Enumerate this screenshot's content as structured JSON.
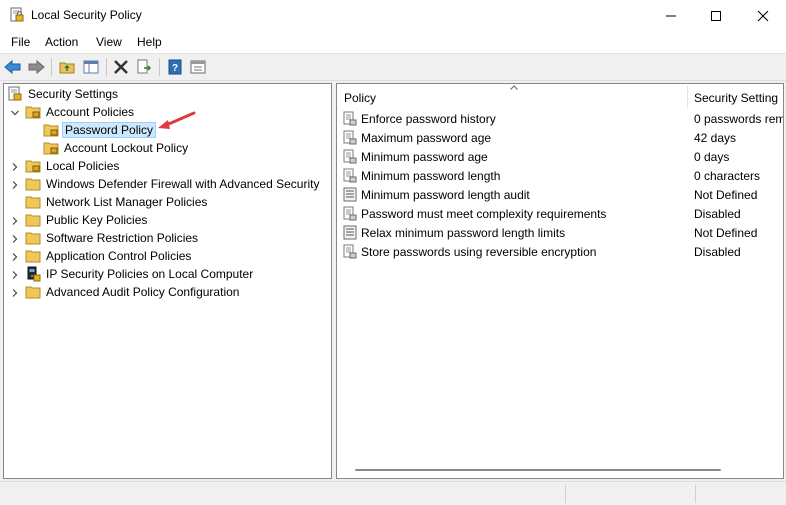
{
  "window": {
    "title": "Local Security Policy"
  },
  "menu": {
    "file": "File",
    "action": "Action",
    "view": "View",
    "help": "Help"
  },
  "tree": {
    "root": "Security Settings",
    "account_policies": "Account Policies",
    "password_policy": "Password Policy",
    "account_lockout_policy": "Account Lockout Policy",
    "local_policies": "Local Policies",
    "firewall": "Windows Defender Firewall with Advanced Security",
    "network_list": "Network List Manager Policies",
    "public_key": "Public Key Policies",
    "software_restriction": "Software Restriction Policies",
    "application_control": "Application Control Policies",
    "ip_security": "IP Security Policies on Local Computer",
    "advanced_audit": "Advanced Audit Policy Configuration"
  },
  "list": {
    "col_policy": "Policy",
    "col_setting": "Security Setting",
    "rows": [
      {
        "policy": "Enforce password history",
        "setting": "0 passwords rem",
        "icon": "policy-doc-icon"
      },
      {
        "policy": "Maximum password age",
        "setting": "42 days",
        "icon": "policy-doc-icon"
      },
      {
        "policy": "Minimum password age",
        "setting": "0 days",
        "icon": "policy-doc-icon"
      },
      {
        "policy": "Minimum password length",
        "setting": "0 characters",
        "icon": "policy-doc-icon"
      },
      {
        "policy": "Minimum password length audit",
        "setting": "Not Defined",
        "icon": "policy-list-icon"
      },
      {
        "policy": "Password must meet complexity requirements",
        "setting": "Disabled",
        "icon": "policy-doc-icon"
      },
      {
        "policy": "Relax minimum password length limits",
        "setting": "Not Defined",
        "icon": "policy-list-icon"
      },
      {
        "policy": "Store passwords using reversible encryption",
        "setting": "Disabled",
        "icon": "policy-doc-icon"
      }
    ]
  },
  "colors": {
    "accent": "#1e73be",
    "selection": "#cce8ff",
    "annotation_arrow": "#e0393e"
  }
}
